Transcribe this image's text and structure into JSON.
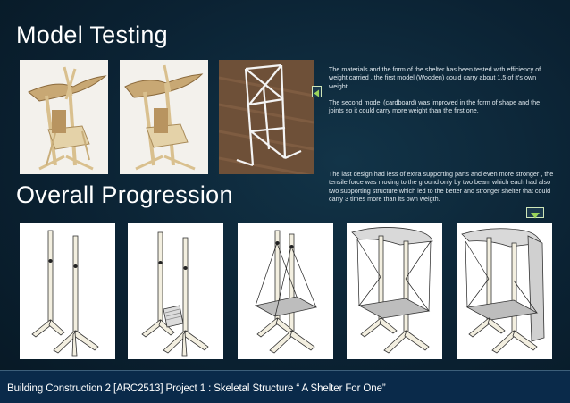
{
  "slide": {
    "title_model_testing": "Model Testing",
    "title_overall_progression": "Overall Progression",
    "paragraph_1": "The materials and the form of the shelter has been tested with efficiency of weight carried , the first model (Wooden) could carry about 1.5 of it's own weight.",
    "paragraph_2": "The second model (cardboard) was improved in the form of shape and the joints so it could carry more weight than the first one.",
    "paragraph_3": "The last design had less of extra supporting parts and even more stronger , the tensile force was moving to the ground only by two beam which each had also two supporting structure which led to the better and stronger shelter that could carry 3 times more than its own weigth.",
    "footer": "Building Construction 2 [ARC2513]  Project 1 : Skeletal Structure “ A Shelter For One”"
  },
  "colors": {
    "background": "#0b2233",
    "footer_bar": "#0a2a4a",
    "arrow_accent": "#9bd45a"
  },
  "icons": {
    "left_arrow": "triangle-left-icon",
    "down_arrow": "triangle-down-icon"
  }
}
